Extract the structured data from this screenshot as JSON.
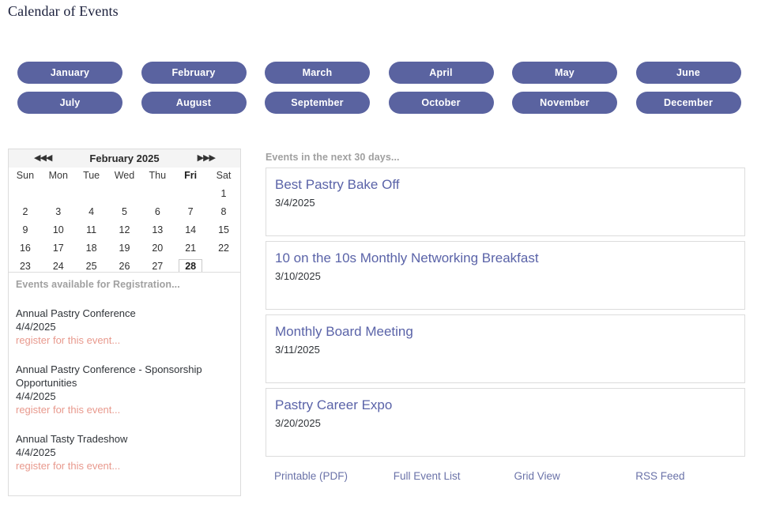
{
  "page": {
    "title": "Calendar of Events"
  },
  "month_buttons": [
    {
      "label": "January"
    },
    {
      "label": "February"
    },
    {
      "label": "March"
    },
    {
      "label": "April"
    },
    {
      "label": "May"
    },
    {
      "label": "June"
    },
    {
      "label": "July"
    },
    {
      "label": "August"
    },
    {
      "label": "September"
    },
    {
      "label": "October"
    },
    {
      "label": "November"
    },
    {
      "label": "December"
    }
  ],
  "calendar": {
    "month_label": "February 2025",
    "prev_nav": "◀◀◀",
    "next_nav": "▶▶▶",
    "day_headers": [
      {
        "label": "Sun",
        "is_today": false
      },
      {
        "label": "Mon",
        "is_today": false
      },
      {
        "label": "Tue",
        "is_today": false
      },
      {
        "label": "Wed",
        "is_today": false
      },
      {
        "label": "Thu",
        "is_today": false
      },
      {
        "label": "Fri",
        "is_today": true
      },
      {
        "label": "Sat",
        "is_today": false
      }
    ],
    "weeks": [
      [
        "",
        "",
        "",
        "",
        "",
        "",
        "1"
      ],
      [
        "2",
        "3",
        "4",
        "5",
        "6",
        "7",
        "8"
      ],
      [
        "9",
        "10",
        "11",
        "12",
        "13",
        "14",
        "15"
      ],
      [
        "16",
        "17",
        "18",
        "19",
        "20",
        "21",
        "22"
      ],
      [
        "23",
        "24",
        "25",
        "26",
        "27",
        "28",
        ""
      ]
    ],
    "event_days": [
      "4",
      "10",
      "11",
      "20"
    ],
    "selected_day": "28"
  },
  "registration_panel": {
    "heading": "Events available for Registration...",
    "items": [
      {
        "title": "Annual Pastry Conference",
        "date": "4/4/2025",
        "link": "register for this event..."
      },
      {
        "title": "Annual Pastry Conference - Sponsorship Opportunities",
        "date": "4/4/2025",
        "link": "register for this event..."
      },
      {
        "title": "Annual Tasty Tradeshow",
        "date": "4/4/2025",
        "link": "register for this event..."
      }
    ]
  },
  "events_panel": {
    "heading": "Events in the next 30 days...",
    "events": [
      {
        "title": "Best Pastry Bake Off",
        "date": "3/4/2025"
      },
      {
        "title": "10 on the 10s Monthly Networking Breakfast",
        "date": "3/10/2025"
      },
      {
        "title": "Monthly Board Meeting",
        "date": "3/11/2025"
      },
      {
        "title": "Pastry Career Expo",
        "date": "3/20/2025"
      }
    ]
  },
  "footer_links": [
    {
      "label": "Printable (PDF)"
    },
    {
      "label": "Full Event List"
    },
    {
      "label": "Grid View"
    },
    {
      "label": "RSS Feed"
    }
  ],
  "colors": {
    "button_bg": "#5a63a0",
    "event_title": "#5a63a8",
    "accent_salmon": "#e8998d",
    "footer_link": "#6a72a8",
    "panel_border": "#dcdcdc",
    "heading_gray": "#a0a0a0"
  }
}
